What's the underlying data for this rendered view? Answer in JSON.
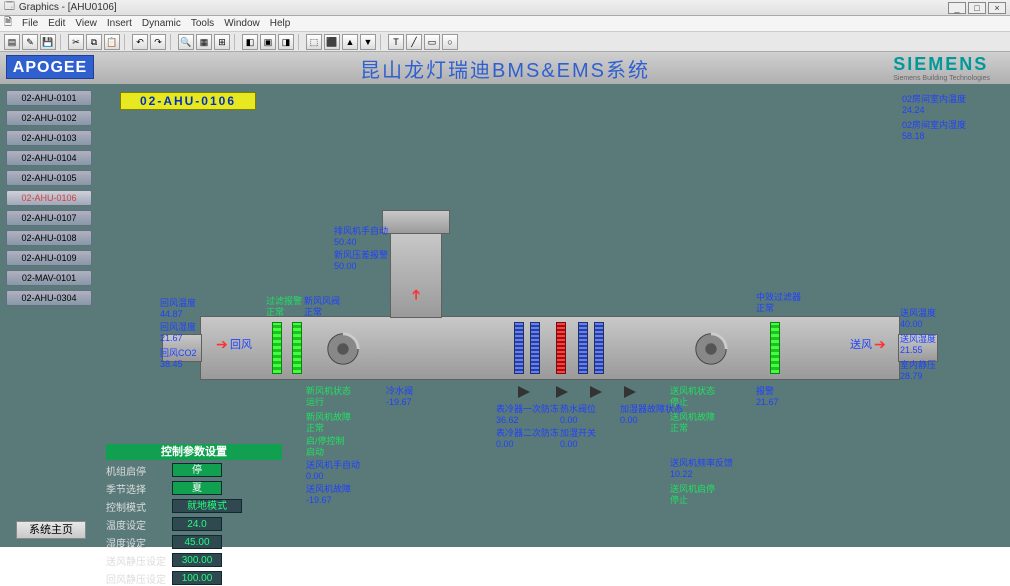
{
  "window": {
    "title": "Graphics - [AHU0106]"
  },
  "menu": {
    "file": "File",
    "edit": "Edit",
    "view": "View",
    "insert": "Insert",
    "dynamic": "Dynamic",
    "tools": "Tools",
    "window": "Window",
    "help": "Help"
  },
  "header": {
    "apogee": "APOGEE",
    "title": "昆山龙灯瑞迪BMS&EMS系统",
    "siemens": "SIEMENS",
    "siemens_sub": "Siemens Building Technologies"
  },
  "nav": {
    "items": [
      {
        "label": "02-AHU-0101"
      },
      {
        "label": "02-AHU-0102"
      },
      {
        "label": "02-AHU-0103"
      },
      {
        "label": "02-AHU-0104"
      },
      {
        "label": "02-AHU-0105"
      },
      {
        "label": "02-AHU-0106"
      },
      {
        "label": "02-AHU-0107"
      },
      {
        "label": "02-AHU-0108"
      },
      {
        "label": "02-AHU-0109"
      },
      {
        "label": "02-MAV-0101"
      },
      {
        "label": "02-AHU-0304"
      }
    ],
    "active_index": 5,
    "home": "系统主页"
  },
  "tag": "02-AHU-0106",
  "labels": {
    "ra_temp_t": "回风温度",
    "ra_temp_v": "44.87",
    "ra_hum_t": "回风湿度",
    "ra_hum_v": "21.67",
    "ra_co2_t": "回风CO2",
    "ra_co2_v": "38.45",
    "return_air": "回风",
    "supply_air": "送风",
    "filter1_t": "过滤报警",
    "filter1_v": "正常",
    "damper_t": "新风风阀",
    "damper_v": "正常",
    "exh_t": "排风机手自动",
    "exh_v": "50.40",
    "exh_p_t": "新风压差报警",
    "exh_p_v": "50.00",
    "rf_state_t": "新风机状态",
    "rf_state_v": "运行",
    "rf_fault_t": "新风机故障",
    "rf_fault_v": "正常",
    "rf_cmd_t": "启/停控制",
    "rf_cmd_v": "启动",
    "rf_auto_t": "送风机手自动",
    "rf_auto_v": "0.00",
    "rf_alarm_t": "送风机故障",
    "rf_alarm_v": "-19.67",
    "cv_t": "冷水阀",
    "cv_v": "-19.67",
    "prefilter_t": "表冷器一次防冻",
    "prefilter_v": "36.62",
    "hv_t": "热水阀位",
    "hv_v": "0.00",
    "reheat1_t": "表冷器二次防冻",
    "reheat1_v": "0.00",
    "reheat2_t": "加湿开关",
    "reheat2_v": "0.00",
    "hum_t": "加湿器故障状态",
    "hum_v": "0.00",
    "sf_state_t": "送风机状态",
    "sf_state_v": "停止",
    "sf_fault_t": "送风机故障",
    "sf_fault_v": "正常",
    "sf_freq_t": "送风机频率反馈",
    "sf_freq_v": "10.22",
    "sf_cmd_t": "送风机启停",
    "sf_cmd_v": "停止",
    "medfilter_t": "中效过滤器",
    "medfilter_v": "正常",
    "safilter_t": "报警",
    "safilter_v": "21.67",
    "sa_temp_t": "送风温度",
    "sa_temp_v": "40.00",
    "sa_hum_t": "送风湿度",
    "sa_hum_v": "21.55",
    "sa_press_t": "室内静压",
    "sa_press_v": "28.79",
    "room_t_t": "02房间室内温度",
    "room_t_v": "24.24",
    "room_h_t": "02房间室内湿度",
    "room_h_v": "58.18"
  },
  "panel": {
    "header": "控制参数设置",
    "rows": [
      {
        "lbl": "机组启停",
        "val": "停",
        "g": true
      },
      {
        "lbl": "季节选择",
        "val": "夏",
        "g": true
      },
      {
        "lbl": "控制模式",
        "val": "就地模式",
        "g": false
      },
      {
        "lbl": "温度设定",
        "val": "24.0",
        "g": false
      },
      {
        "lbl": "湿度设定",
        "val": "45.00",
        "g": false
      },
      {
        "lbl": "送风静压设定",
        "val": "300.00",
        "g": false
      },
      {
        "lbl": "回风静压设定",
        "val": "100.00",
        "g": false
      }
    ]
  }
}
